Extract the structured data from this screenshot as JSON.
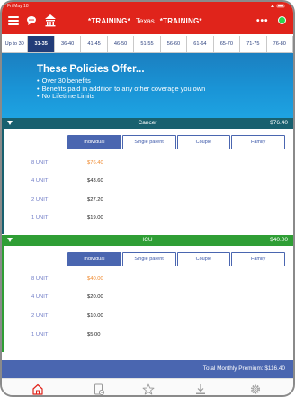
{
  "status_bar": {
    "carrier_time": "Fri May 18",
    "icons": "wifi battery"
  },
  "header": {
    "title_left": "*TRAINING*",
    "state": "Texas",
    "title_right": "*TRAINING*",
    "more_label": "•••",
    "bg_color": "#e0241b"
  },
  "age_tabs": [
    {
      "label": "Up to 30"
    },
    {
      "label": "31-35"
    },
    {
      "label": "36-40"
    },
    {
      "label": "41-45"
    },
    {
      "label": "46-50"
    },
    {
      "label": "51-55"
    },
    {
      "label": "56-60"
    },
    {
      "label": "61-64"
    },
    {
      "label": "65-70"
    },
    {
      "label": "71-75"
    },
    {
      "label": "76-80"
    }
  ],
  "age_tabs_selected": "31-35",
  "hero": {
    "title": "These Policies Offer...",
    "bullets": [
      "Over 30 benefits",
      "Benefits paid in addition to any other coverage you own",
      "No Lifetime Limits"
    ]
  },
  "sections": {
    "cancer": {
      "name": "Cancer",
      "price": "$76.40",
      "color": "#18606f",
      "tabs": [
        "Individual",
        "Single parent",
        "Couple",
        "Family"
      ],
      "selected_tab": "Individual",
      "units": [
        {
          "label": "8 UNIT",
          "price": "$76.40",
          "selected": true
        },
        {
          "label": "4 UNIT",
          "price": "$43.60",
          "selected": false
        },
        {
          "label": "2 UNIT",
          "price": "$27.20",
          "selected": false
        },
        {
          "label": "1 UNIT",
          "price": "$19.00",
          "selected": false
        }
      ]
    },
    "icu": {
      "name": "ICU",
      "price": "$40.00",
      "color": "#2f9e35",
      "tabs": [
        "Individual",
        "Single parent",
        "Couple",
        "Family"
      ],
      "selected_tab": "Individual",
      "units": [
        {
          "label": "8 UNIT",
          "price": "$40.00",
          "selected": true
        },
        {
          "label": "4 UNIT",
          "price": "$20.00",
          "selected": false
        },
        {
          "label": "2 UNIT",
          "price": "$10.00",
          "selected": false
        },
        {
          "label": "1 UNIT",
          "price": "$5.00",
          "selected": false
        }
      ]
    }
  },
  "total": {
    "label": "Total Monthly Premium:",
    "value": "$116.40"
  },
  "bottom_nav": [
    "home-icon",
    "document-icon",
    "star-icon",
    "download-icon",
    "gear-icon"
  ]
}
